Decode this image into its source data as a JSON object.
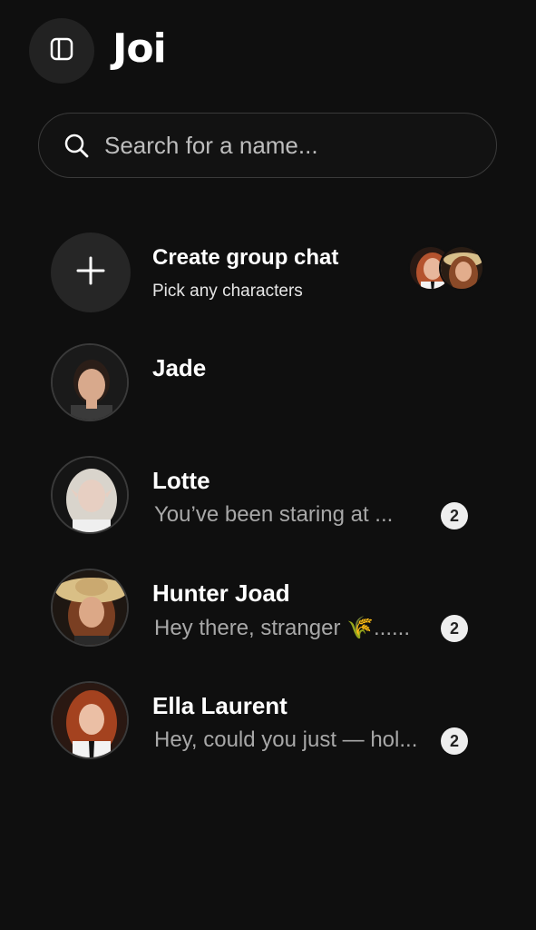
{
  "app": {
    "logo": "Joi"
  },
  "search": {
    "placeholder": "Search for a name..."
  },
  "group_chat": {
    "title": "Create group chat",
    "subtitle": "Pick any characters"
  },
  "chats": [
    {
      "name": "Jade",
      "preview": "",
      "badge": ""
    },
    {
      "name": "Lotte",
      "preview": "You’ve been staring at ...",
      "badge": "2"
    },
    {
      "name": "Hunter Joad",
      "preview": "Hey there, stranger 🌾......",
      "badge": "2"
    },
    {
      "name": "Ella Laurent",
      "preview": "Hey, could you just — hol...",
      "badge": "2"
    }
  ],
  "colors": {
    "background": "#0f0f0f",
    "surface": "#222222",
    "badge": "#eeeeee",
    "preview_text": "#a8a8a8"
  }
}
